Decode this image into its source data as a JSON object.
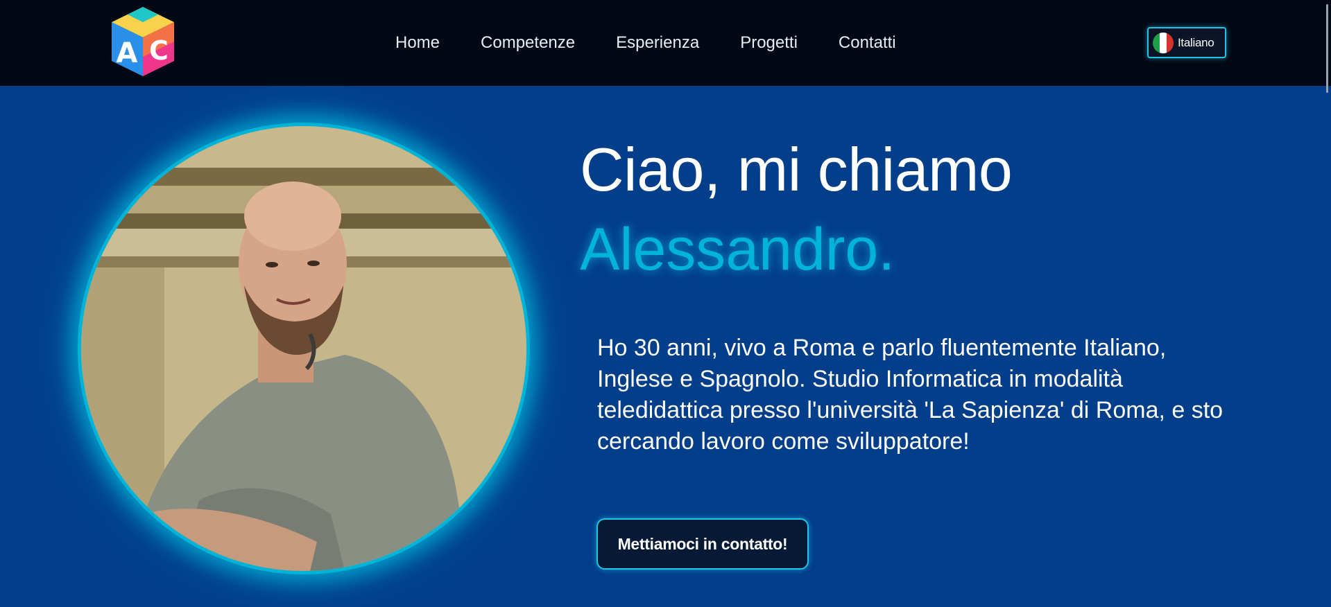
{
  "header": {
    "logo_letters": [
      "A",
      "C"
    ],
    "nav": [
      {
        "label": "Home"
      },
      {
        "label": "Competenze"
      },
      {
        "label": "Esperienza"
      },
      {
        "label": "Progetti"
      },
      {
        "label": "Contatti"
      }
    ],
    "language": {
      "label": "Italiano",
      "flag_icon": "italy-flag-icon"
    }
  },
  "hero": {
    "greeting": "Ciao, mi chiamo",
    "name": "Alessandro.",
    "bio": "Ho 30 anni, vivo a Roma e parlo fluentemente Italiano, Inglese e Spagnolo. Studio Informatica in modalità teledidattica presso l'università 'La Sapienza' di Roma, e sto cercando lavoro come sviluppatore!",
    "cta_label": "Mettiamoci in contatto!"
  },
  "colors": {
    "header_bg": "#020814",
    "hero_bg": "#023e8a",
    "accent": "#00b4d8"
  }
}
